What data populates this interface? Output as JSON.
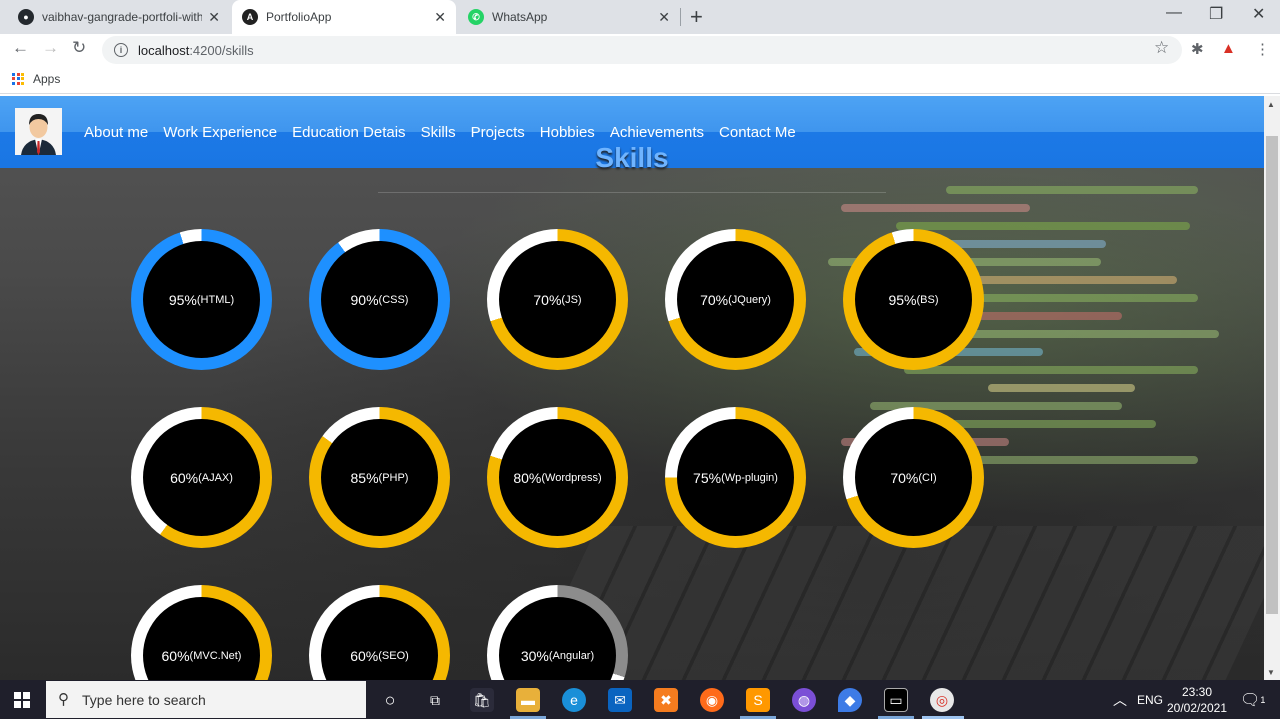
{
  "browser": {
    "tabs": [
      {
        "title": "vaibhav-gangrade-portfoli-with-j",
        "favicon": "github-icon",
        "active": false
      },
      {
        "title": "PortfolioApp",
        "favicon": "angular-icon",
        "active": true
      },
      {
        "title": "WhatsApp",
        "favicon": "whatsapp-icon",
        "active": false
      }
    ],
    "url_host": "localhost",
    "url_path": ":4200/skills",
    "bookmarks_apps": "Apps"
  },
  "site": {
    "nav": [
      "About me",
      "Work Experience",
      "Education Detais",
      "Skills",
      "Projects",
      "Hobbies",
      "Achievements",
      "Contact Me"
    ],
    "heading": "Skills",
    "colors": {
      "navbar": "#2d86ea",
      "heading": "#6fb4ff",
      "blue_ring": "#1e90ff",
      "yellow_ring": "#f5b800",
      "grey_ring": "#8c8c8c"
    },
    "skills": [
      {
        "percent": "95%",
        "name": "(HTML)",
        "value": 95,
        "color": "#1e90ff"
      },
      {
        "percent": "90%",
        "name": "(CSS)",
        "value": 90,
        "color": "#1e90ff"
      },
      {
        "percent": "70%",
        "name": "(JS)",
        "value": 70,
        "color": "#f5b800"
      },
      {
        "percent": "70%",
        "name": "(JQuery)",
        "value": 70,
        "color": "#f5b800"
      },
      {
        "percent": "95%",
        "name": "(BS)",
        "value": 95,
        "color": "#f5b800"
      },
      {
        "percent": "60%",
        "name": "(AJAX)",
        "value": 60,
        "color": "#f5b800"
      },
      {
        "percent": "85%",
        "name": "(PHP)",
        "value": 85,
        "color": "#f5b800"
      },
      {
        "percent": "80%",
        "name": "(Wordpress)",
        "value": 80,
        "color": "#f5b800"
      },
      {
        "percent": "75%",
        "name": "(Wp-plugin)",
        "value": 75,
        "color": "#f5b800"
      },
      {
        "percent": "70%",
        "name": "(CI)",
        "value": 70,
        "color": "#f5b800"
      },
      {
        "percent": "60%",
        "name": "(MVC.Net)",
        "value": 60,
        "color": "#f5b800"
      },
      {
        "percent": "60%",
        "name": "(SEO)",
        "value": 60,
        "color": "#f5b800"
      },
      {
        "percent": "30%",
        "name": "(Angular)",
        "value": 30,
        "color": "#8c8c8c"
      }
    ]
  },
  "taskbar": {
    "search_placeholder": "Type here to search",
    "language": "ENG",
    "time": "23:30",
    "date": "20/02/2021",
    "notifications": "1"
  }
}
